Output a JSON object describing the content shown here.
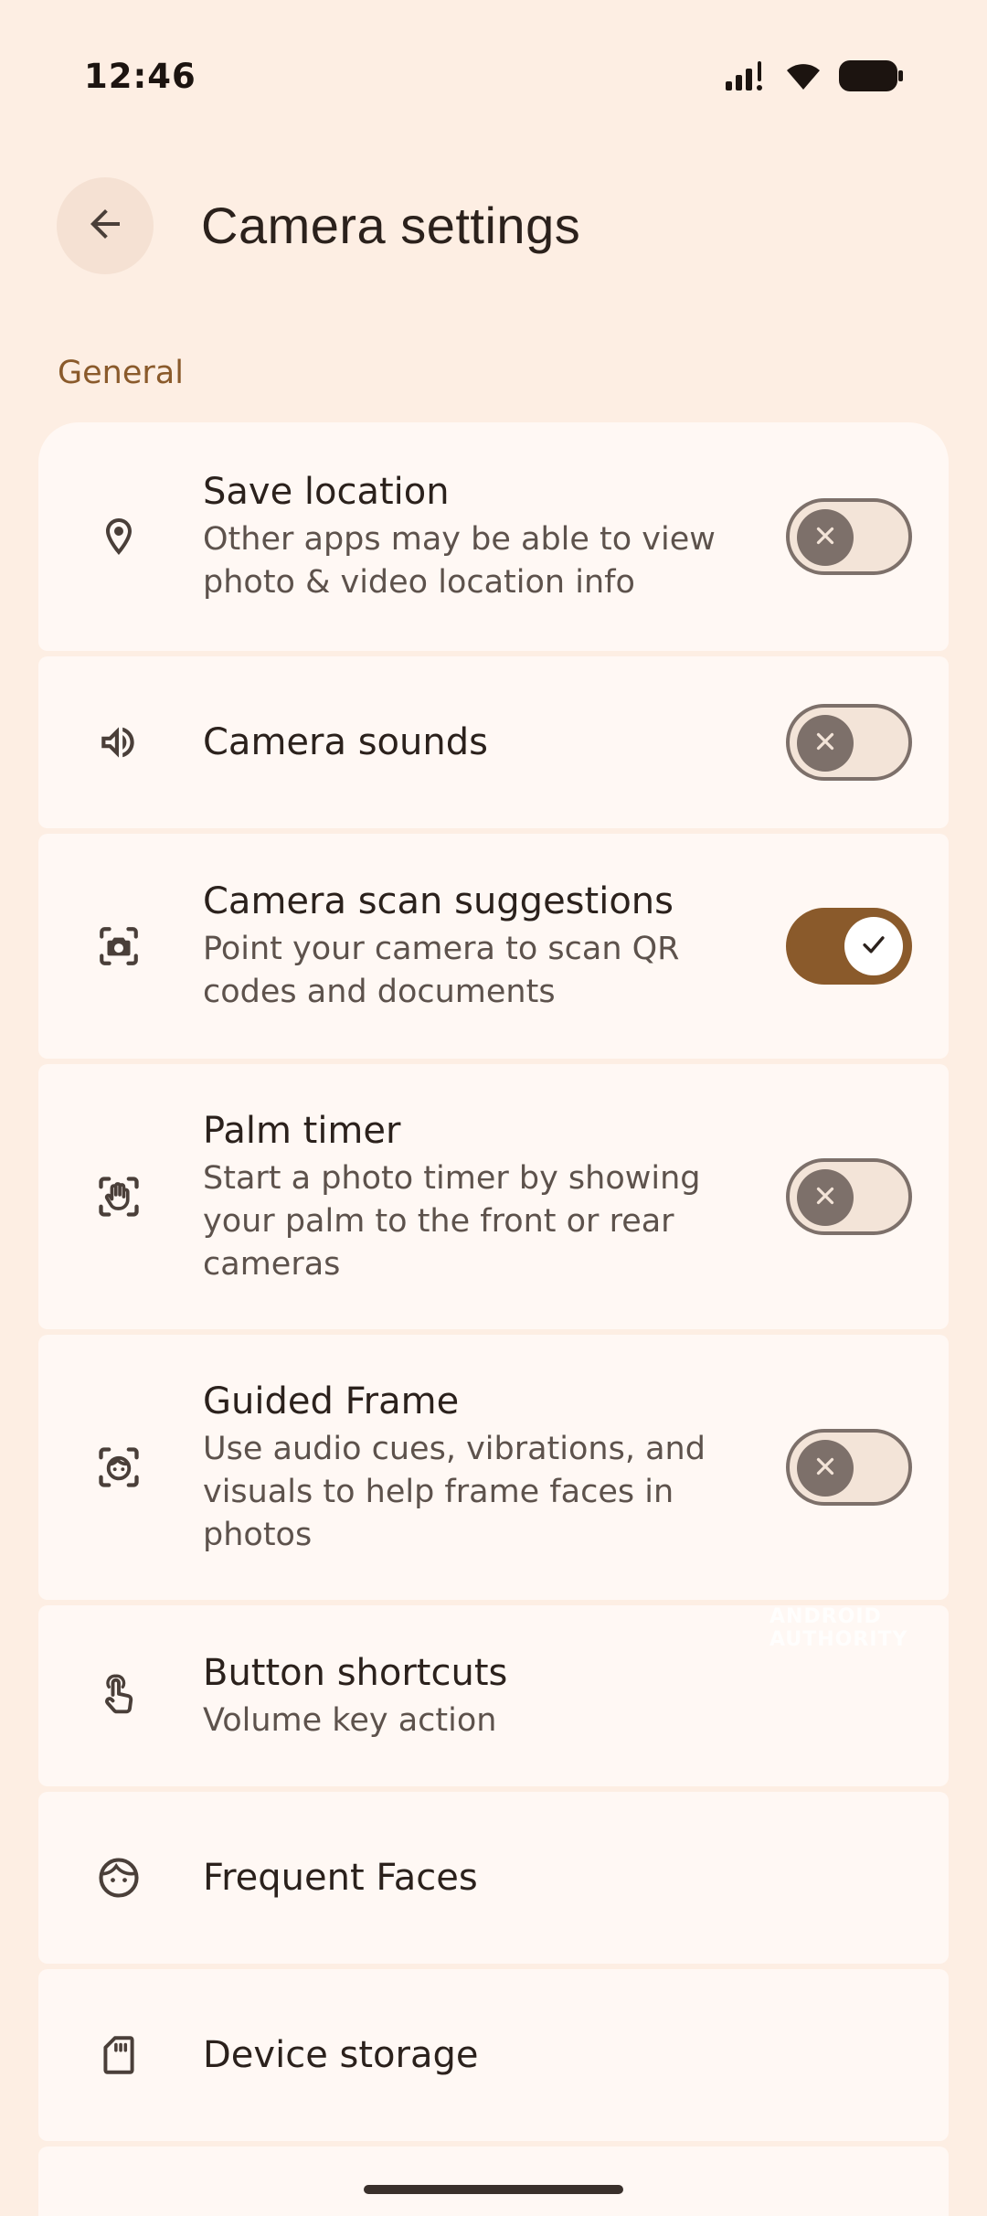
{
  "status_bar": {
    "time": "12:46"
  },
  "header": {
    "title": "Camera settings"
  },
  "section": {
    "label": "General"
  },
  "items": [
    {
      "title": "Save location",
      "subtitle": "Other apps may be able to view photo & video location info",
      "icon": "location-pin-icon",
      "toggle": false
    },
    {
      "title": "Camera sounds",
      "icon": "speaker-icon",
      "toggle": false
    },
    {
      "title": "Camera scan suggestions",
      "subtitle": "Point your camera to scan QR codes and documents",
      "icon": "camera-scan-icon",
      "toggle": true
    },
    {
      "title": "Palm timer",
      "subtitle": "Start a photo timer by showing your palm to the front or rear cameras",
      "icon": "palm-icon",
      "toggle": false
    },
    {
      "title": "Guided Frame",
      "subtitle": "Use audio cues, vibrations, and visuals to help frame faces in photos",
      "icon": "face-frame-icon",
      "toggle": false
    },
    {
      "title": "Button shortcuts",
      "subtitle": "Volume key action",
      "icon": "touch-icon"
    },
    {
      "title": "Frequent Faces",
      "icon": "face-icon"
    },
    {
      "title": "Device storage",
      "icon": "sd-card-icon"
    }
  ],
  "watermark": "ANDROID AUTHORITY",
  "colors": {
    "background": "#fdeee3",
    "card": "#fff8f4",
    "accent": "#8a5a2b",
    "toggle_off": "#7d706a"
  }
}
